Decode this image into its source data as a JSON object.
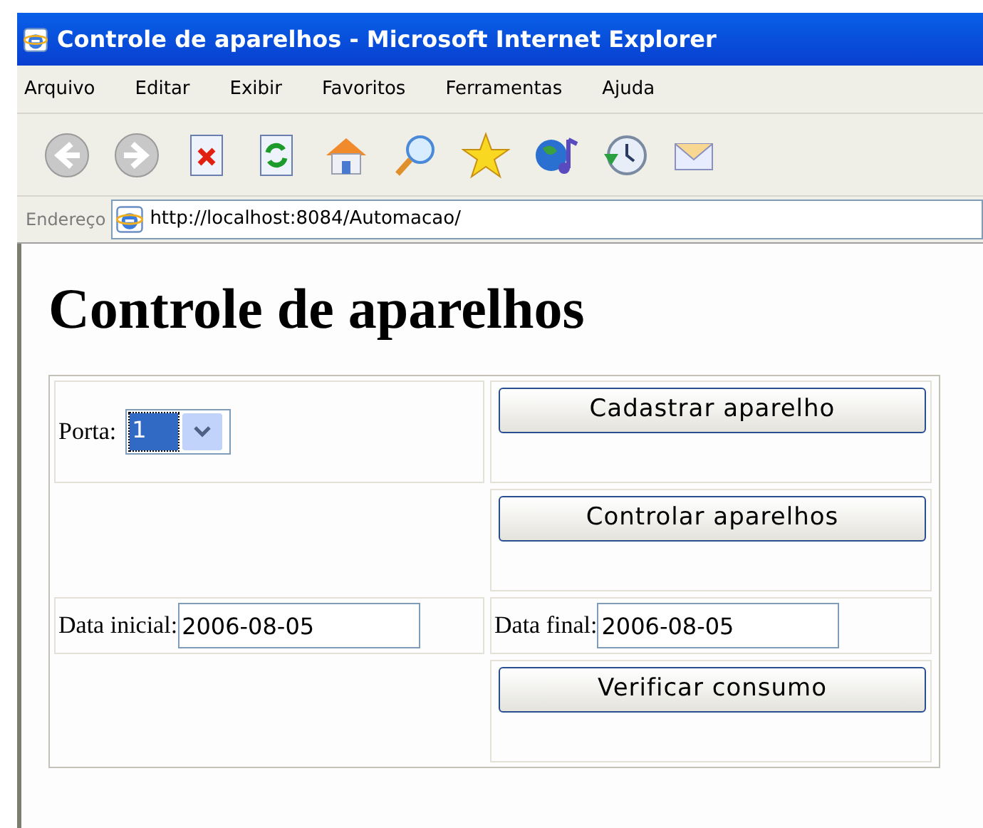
{
  "window": {
    "title": "Controle de aparelhos - Microsoft Internet Explorer"
  },
  "menu": [
    "Arquivo",
    "Editar",
    "Exibir",
    "Favoritos",
    "Ferramentas",
    "Ajuda"
  ],
  "address_bar": {
    "label": "Endereço",
    "url": "http://localhost:8084/Automacao/"
  },
  "page": {
    "heading": "Controle de aparelhos",
    "port": {
      "label": "Porta:",
      "value": "1",
      "focused": true
    },
    "buttons": [
      "Cadastrar aparelho",
      "Controlar aparelhos",
      "Verificar consumo"
    ],
    "start_date": {
      "label": "Data inicial:",
      "value": "2006-08-05"
    },
    "end_date": {
      "label": "Data final:",
      "value": "2006-08-05"
    }
  }
}
